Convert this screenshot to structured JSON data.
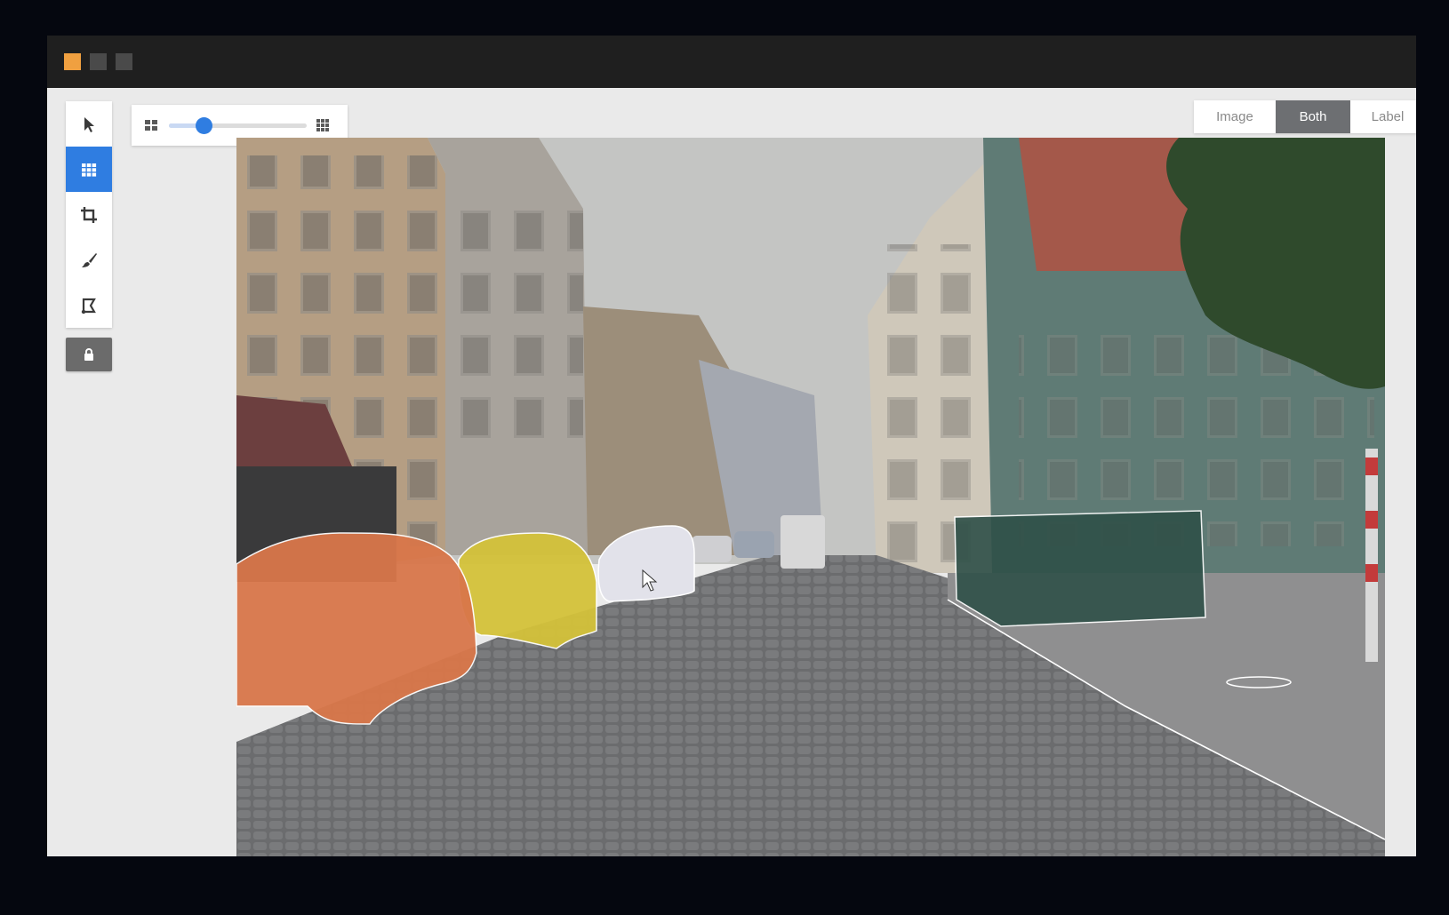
{
  "window": {
    "buttons": [
      {
        "name": "orange",
        "color": "#f0a040"
      },
      {
        "name": "gray",
        "color": "#4a4a4a"
      },
      {
        "name": "gray",
        "color": "#4a4a4a"
      }
    ]
  },
  "toolbar": {
    "tools": [
      {
        "id": "select",
        "icon": "pointer-icon",
        "active": false
      },
      {
        "id": "grid",
        "icon": "grid-icon",
        "active": true
      },
      {
        "id": "crop",
        "icon": "crop-icon",
        "active": false
      },
      {
        "id": "brush",
        "icon": "brush-icon",
        "active": false
      },
      {
        "id": "polygon",
        "icon": "polygon-icon",
        "active": false
      }
    ],
    "lock": {
      "icon": "lock-icon",
      "locked": true
    },
    "accent": "#2f7de1"
  },
  "zoom": {
    "min_icon": "small-grid-icon",
    "max_icon": "large-grid-icon",
    "value": 0.25
  },
  "view_mode": {
    "options": [
      "Image",
      "Both",
      "Label"
    ],
    "selected": "Both"
  },
  "segments": {
    "colors": {
      "car_orange": "#d9774a",
      "car_yellow": "#d4c23a",
      "car_white": "#e2e2ea",
      "wall_dark": "#2f5048",
      "road": "#6e6e70",
      "sky": "#c4c5c3"
    }
  }
}
